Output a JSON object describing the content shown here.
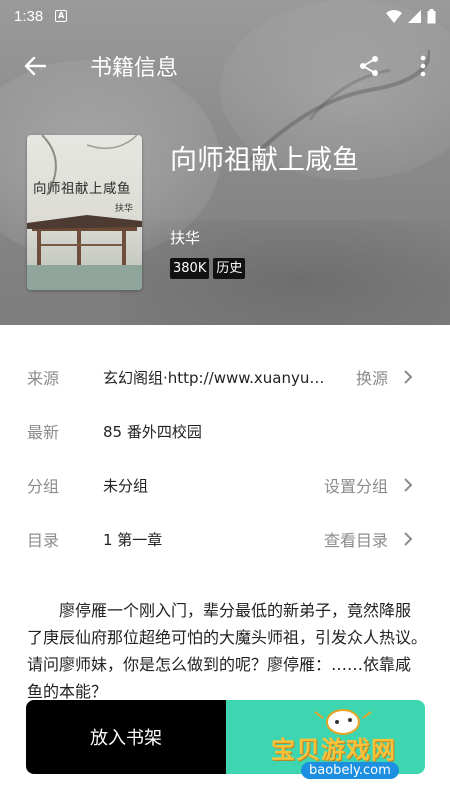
{
  "status_bar": {
    "time": "1:38",
    "badge": "A"
  },
  "toolbar": {
    "title": "书籍信息"
  },
  "book": {
    "title": "向师祖献上咸鱼",
    "author": "扶华",
    "cover_title": "向师祖献上咸鱼",
    "cover_author": "扶华",
    "tags": [
      "380K",
      "历史"
    ]
  },
  "info": {
    "source": {
      "label": "来源",
      "value": "玄幻阁组·http://www.xuanyuange.org",
      "action": "换源"
    },
    "latest": {
      "label": "最新",
      "value": "85 番外四校园"
    },
    "group": {
      "label": "分组",
      "value": "未分组",
      "action": "设置分组"
    },
    "toc": {
      "label": "目录",
      "value": "1 第一章",
      "action": "查看目录"
    }
  },
  "description": "廖停雁一个刚入门，辈分最低的新弟子，竟然降服了庚辰仙府那位超绝可怕的大魔头师祖，引发众人热议。　请问廖师妹，你是怎么做到的呢？廖停雁：……依靠咸鱼的本能？",
  "actions": {
    "add_to_shelf": "放入书架"
  },
  "watermark": {
    "text": "宝贝游戏网",
    "url": "baobely.com"
  },
  "colors": {
    "accent": "#3dd6b0",
    "shelf_button": "#000000"
  }
}
